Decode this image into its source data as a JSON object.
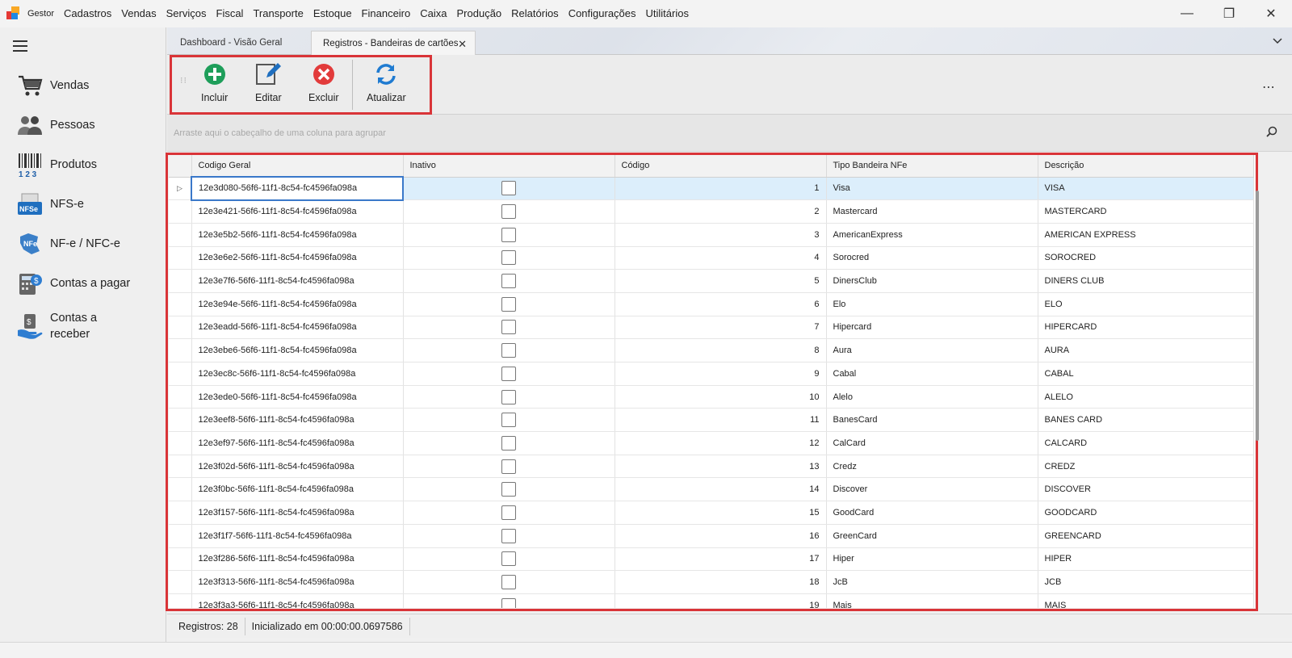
{
  "window": {
    "app_menu_label": "Gestor",
    "menu": [
      "Cadastros",
      "Vendas",
      "Serviços",
      "Fiscal",
      "Transporte",
      "Estoque",
      "Financeiro",
      "Caixa",
      "Produção",
      "Relatórios",
      "Configurações",
      "Utilitários"
    ],
    "controls": {
      "minimize": "—",
      "restore": "❐",
      "close": "✕"
    }
  },
  "sidebar": {
    "items": [
      {
        "label": "Vendas",
        "icon": "cart-icon"
      },
      {
        "label": "Pessoas",
        "icon": "people-icon"
      },
      {
        "label": "Produtos",
        "icon": "barcode-icon"
      },
      {
        "label": "NFS-e",
        "icon": "nfse-icon"
      },
      {
        "label": "NF-e / NFC-e",
        "icon": "nfe-icon"
      },
      {
        "label": "Contas a pagar",
        "icon": "calculator-money-icon"
      },
      {
        "label": "Contas a receber",
        "icon": "hand-money-icon"
      }
    ]
  },
  "tabs": [
    {
      "label": "Dashboard - Visão Geral",
      "active": false
    },
    {
      "label": "Registros - Bandeiras de cartões",
      "active": true,
      "close": "✕"
    }
  ],
  "toolbar": {
    "include_label": "Incluir",
    "edit_label": "Editar",
    "delete_label": "Excluir",
    "refresh_label": "Atualizar",
    "more": "⋯",
    "colors": {
      "include": "#1e9e5a",
      "edit": "#1f6fbf",
      "delete": "#e23b3b",
      "refresh": "#1f7bd1"
    }
  },
  "grouppanel": {
    "hint": "Arraste aqui o cabeçalho de uma coluna para agrupar"
  },
  "grid": {
    "columns": [
      "Codigo Geral",
      "Inativo",
      "Código",
      "Tipo Bandeira NFe",
      "Descrição"
    ],
    "rows": [
      {
        "id": "12e3d080-56f6-11f1-8c54-fc4596fa098a",
        "inativo": false,
        "codigo": "1",
        "tipo": "Visa",
        "descricao": "VISA"
      },
      {
        "id": "12e3e421-56f6-11f1-8c54-fc4596fa098a",
        "inativo": false,
        "codigo": "2",
        "tipo": "Mastercard",
        "descricao": "MASTERCARD"
      },
      {
        "id": "12e3e5b2-56f6-11f1-8c54-fc4596fa098a",
        "inativo": false,
        "codigo": "3",
        "tipo": "AmericanExpress",
        "descricao": "AMERICAN EXPRESS"
      },
      {
        "id": "12e3e6e2-56f6-11f1-8c54-fc4596fa098a",
        "inativo": false,
        "codigo": "4",
        "tipo": "Sorocred",
        "descricao": "SOROCRED"
      },
      {
        "id": "12e3e7f6-56f6-11f1-8c54-fc4596fa098a",
        "inativo": false,
        "codigo": "5",
        "tipo": "DinersClub",
        "descricao": "DINERS CLUB"
      },
      {
        "id": "12e3e94e-56f6-11f1-8c54-fc4596fa098a",
        "inativo": false,
        "codigo": "6",
        "tipo": "Elo",
        "descricao": "ELO"
      },
      {
        "id": "12e3eadd-56f6-11f1-8c54-fc4596fa098a",
        "inativo": false,
        "codigo": "7",
        "tipo": "Hipercard",
        "descricao": "HIPERCARD"
      },
      {
        "id": "12e3ebe6-56f6-11f1-8c54-fc4596fa098a",
        "inativo": false,
        "codigo": "8",
        "tipo": "Aura",
        "descricao": "AURA"
      },
      {
        "id": "12e3ec8c-56f6-11f1-8c54-fc4596fa098a",
        "inativo": false,
        "codigo": "9",
        "tipo": "Cabal",
        "descricao": "CABAL"
      },
      {
        "id": "12e3ede0-56f6-11f1-8c54-fc4596fa098a",
        "inativo": false,
        "codigo": "10",
        "tipo": "Alelo",
        "descricao": "ALELO"
      },
      {
        "id": "12e3eef8-56f6-11f1-8c54-fc4596fa098a",
        "inativo": false,
        "codigo": "11",
        "tipo": "BanesCard",
        "descricao": "BANES CARD"
      },
      {
        "id": "12e3ef97-56f6-11f1-8c54-fc4596fa098a",
        "inativo": false,
        "codigo": "12",
        "tipo": "CalCard",
        "descricao": "CALCARD"
      },
      {
        "id": "12e3f02d-56f6-11f1-8c54-fc4596fa098a",
        "inativo": false,
        "codigo": "13",
        "tipo": "Credz",
        "descricao": "CREDZ"
      },
      {
        "id": "12e3f0bc-56f6-11f1-8c54-fc4596fa098a",
        "inativo": false,
        "codigo": "14",
        "tipo": "Discover",
        "descricao": "DISCOVER"
      },
      {
        "id": "12e3f157-56f6-11f1-8c54-fc4596fa098a",
        "inativo": false,
        "codigo": "15",
        "tipo": "GoodCard",
        "descricao": "GOODCARD"
      },
      {
        "id": "12e3f1f7-56f6-11f1-8c54-fc4596fa098a",
        "inativo": false,
        "codigo": "16",
        "tipo": "GreenCard",
        "descricao": "GREENCARD"
      },
      {
        "id": "12e3f286-56f6-11f1-8c54-fc4596fa098a",
        "inativo": false,
        "codigo": "17",
        "tipo": "Hiper",
        "descricao": "HIPER"
      },
      {
        "id": "12e3f313-56f6-11f1-8c54-fc4596fa098a",
        "inativo": false,
        "codigo": "18",
        "tipo": "JcB",
        "descricao": "JCB"
      },
      {
        "id": "12e3f3a3-56f6-11f1-8c54-fc4596fa098a",
        "inativo": false,
        "codigo": "19",
        "tipo": "Mais",
        "descricao": "MAIS"
      }
    ],
    "selected_row_marker": "▷"
  },
  "status": {
    "records": "Registros: 28",
    "initialized": "Inicializado em 00:00:00.0697586"
  },
  "highlight_color": "#d93438"
}
